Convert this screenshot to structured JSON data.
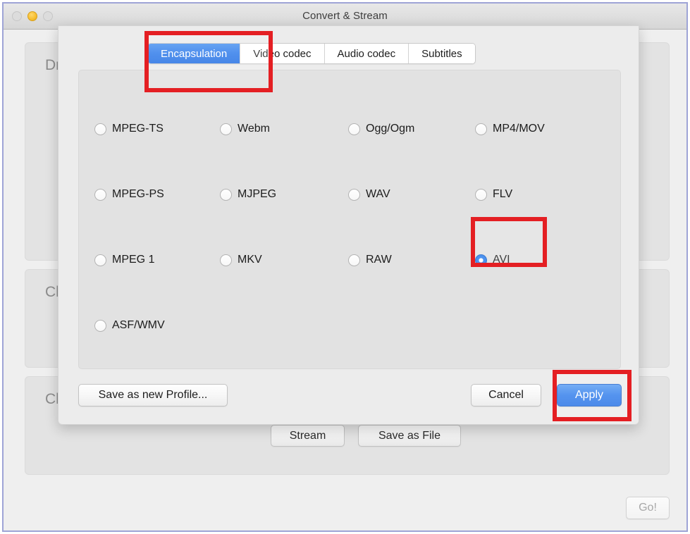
{
  "window": {
    "title": "Convert & Stream",
    "traffic_lights": [
      {
        "name": "close",
        "state": "disabled"
      },
      {
        "name": "minimize",
        "state": "active",
        "color": "#f6bd2f"
      },
      {
        "name": "zoom",
        "state": "disabled"
      }
    ]
  },
  "background": {
    "panels": [
      {
        "label": "Dr"
      },
      {
        "label": "Ch"
      },
      {
        "label": "Ch"
      }
    ],
    "buttons": {
      "stream": "Stream",
      "save_as_file": "Save as File",
      "go": "Go!"
    }
  },
  "sheet": {
    "tabs": [
      {
        "label": "Encapsulation",
        "active": true
      },
      {
        "label": "Video codec",
        "active": false
      },
      {
        "label": "Audio codec",
        "active": false
      },
      {
        "label": "Subtitles",
        "active": false
      }
    ],
    "options": [
      {
        "label": "MPEG-TS",
        "selected": false,
        "col": 0,
        "row": 0
      },
      {
        "label": "Webm",
        "selected": false,
        "col": 1,
        "row": 0
      },
      {
        "label": "Ogg/Ogm",
        "selected": false,
        "col": 2,
        "row": 0
      },
      {
        "label": "MP4/MOV",
        "selected": false,
        "col": 3,
        "row": 0
      },
      {
        "label": "MPEG-PS",
        "selected": false,
        "col": 0,
        "row": 1
      },
      {
        "label": "MJPEG",
        "selected": false,
        "col": 1,
        "row": 1
      },
      {
        "label": "WAV",
        "selected": false,
        "col": 2,
        "row": 1
      },
      {
        "label": "FLV",
        "selected": false,
        "col": 3,
        "row": 1
      },
      {
        "label": "MPEG 1",
        "selected": false,
        "col": 0,
        "row": 2
      },
      {
        "label": "MKV",
        "selected": false,
        "col": 1,
        "row": 2
      },
      {
        "label": "RAW",
        "selected": false,
        "col": 2,
        "row": 2
      },
      {
        "label": "AVI",
        "selected": true,
        "col": 3,
        "row": 2
      },
      {
        "label": "ASF/WMV",
        "selected": false,
        "col": 0,
        "row": 3
      }
    ],
    "selected_option": "AVI",
    "footer": {
      "save_as_new_profile": "Save as new Profile...",
      "cancel": "Cancel",
      "apply": "Apply"
    }
  },
  "annotations": {
    "color": "#e41f23",
    "targets": [
      "Encapsulation tab",
      "AVI radio option",
      "Apply button"
    ]
  },
  "colors": {
    "accent_blue": "#2f7bea",
    "highlight_red": "#e41f23",
    "window_border": "#9ea4d6",
    "minimize_yellow": "#f6bd2f"
  }
}
